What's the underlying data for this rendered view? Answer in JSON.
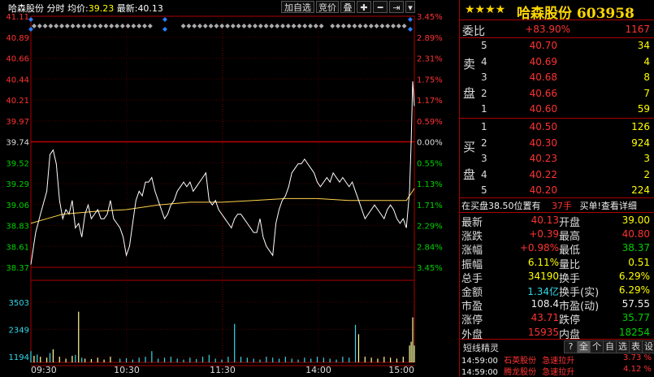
{
  "header": {
    "stock_name": "哈森股份",
    "mode": "分时",
    "avg_label": "均价:",
    "avg_value": "39.23",
    "last_label": "最新:",
    "last_value": "40.13",
    "buttons": [
      "加自选",
      "竞价",
      "叠"
    ],
    "icons": [
      "plus-icon",
      "minus-icon",
      "skip-end-icon",
      "chevron-down-icon"
    ]
  },
  "stock_header": {
    "stars": "★★★★",
    "title": "哈森股份 603958"
  },
  "weibi": {
    "label": "委比",
    "pct": "+83.90%",
    "value": "1167"
  },
  "sell_side_label": [
    "卖",
    "盘"
  ],
  "buy_side_label": [
    "买",
    "盘"
  ],
  "asks": [
    {
      "level": "5",
      "price": "40.70",
      "vol": "34"
    },
    {
      "level": "4",
      "price": "40.69",
      "vol": "4"
    },
    {
      "level": "3",
      "price": "40.68",
      "vol": "8"
    },
    {
      "level": "2",
      "price": "40.66",
      "vol": "7"
    },
    {
      "level": "1",
      "price": "40.60",
      "vol": "59"
    }
  ],
  "bids": [
    {
      "level": "1",
      "price": "40.50",
      "vol": "126"
    },
    {
      "level": "2",
      "price": "40.30",
      "vol": "924"
    },
    {
      "level": "3",
      "price": "40.23",
      "vol": "3"
    },
    {
      "level": "4",
      "price": "40.22",
      "vol": "2"
    },
    {
      "level": "5",
      "price": "40.20",
      "vol": "224"
    }
  ],
  "notice": {
    "text": "在买盘38.50位置有",
    "hands": "37手",
    "action": "买单!查看详细"
  },
  "quote": [
    {
      "l1": "最新",
      "v1": "40.13",
      "c1": "red",
      "l2": "开盘",
      "v2": "39.00",
      "c2": "yl"
    },
    {
      "l1": "涨跌",
      "v1": "+0.39",
      "c1": "red",
      "l2": "最高",
      "v2": "40.80",
      "c2": "red"
    },
    {
      "l1": "涨幅",
      "v1": "+0.98%",
      "c1": "red",
      "l2": "最低",
      "v2": "38.37",
      "c2": "grn"
    },
    {
      "l1": "振幅",
      "v1": "6.11%",
      "c1": "yl",
      "l2": "量比",
      "v2": "0.51",
      "c2": "yl"
    },
    {
      "l1": "总手",
      "v1": "34190",
      "c1": "yl",
      "l2": "换手",
      "v2": "6.29%",
      "c2": "yl"
    },
    {
      "l1": "金额",
      "v1": "1.34亿",
      "c1": "cy",
      "l2": "换手(实)",
      "v2": "6.29%",
      "c2": "yl"
    },
    {
      "l1": "市盈",
      "v1": "108.4",
      "c1": "wt",
      "l2": "市盈(动)",
      "v2": "57.55",
      "c2": "wt"
    },
    {
      "l1": "涨停",
      "v1": "43.71",
      "c1": "red",
      "l2": "跌停",
      "v2": "35.77",
      "c2": "grn"
    },
    {
      "l1": "外盘",
      "v1": "15935",
      "c1": "red",
      "l2": "内盘",
      "v2": "18254",
      "c2": "grn"
    }
  ],
  "sprite": {
    "title": "短线精灵",
    "tabs": [
      "?",
      "全",
      "个",
      "自",
      "选",
      "表",
      "设"
    ],
    "items": [
      {
        "time": "14:59:00",
        "name": "石英股份",
        "event": "急速拉升",
        "pct": "3.73 %"
      },
      {
        "time": "14:59:00",
        "name": "腾龙股份",
        "event": "急速拉升",
        "pct": "4.12 %"
      }
    ]
  },
  "chart_data": {
    "type": "line",
    "title": "",
    "prev_close": 39.74,
    "price_ticks": [
      "41.11",
      "40.89",
      "40.66",
      "40.44",
      "40.21",
      "39.97",
      "39.74",
      "39.52",
      "39.29",
      "39.06",
      "38.83",
      "38.61",
      "38.37"
    ],
    "pct_ticks": [
      "3.45%",
      "2.89%",
      "2.31%",
      "1.75%",
      "1.17%",
      "0.59%",
      "0.00%",
      "0.55%",
      "1.13%",
      "1.71%",
      "2.29%",
      "2.84%",
      "3.45%"
    ],
    "volume_ticks": [
      "3503",
      "2349",
      "1194"
    ],
    "time_ticks": [
      "09:30",
      "10:30",
      "11:30",
      "14:00",
      "15:00"
    ],
    "ylim": [
      38.37,
      41.11
    ],
    "volume_max": 4200,
    "price_series": {
      "name": "",
      "points": [
        [
          0,
          38.4
        ],
        [
          3,
          38.75
        ],
        [
          6,
          38.95
        ],
        [
          10,
          39.2
        ],
        [
          12,
          39.6
        ],
        [
          14,
          39.65
        ],
        [
          16,
          39.5
        ],
        [
          18,
          39.1
        ],
        [
          20,
          38.9
        ],
        [
          22,
          39.0
        ],
        [
          24,
          38.95
        ],
        [
          26,
          39.1
        ],
        [
          28,
          38.8
        ],
        [
          30,
          38.85
        ],
        [
          32,
          38.7
        ],
        [
          34,
          38.95
        ],
        [
          36,
          39.05
        ],
        [
          38,
          38.9
        ],
        [
          40,
          38.95
        ],
        [
          42,
          39.0
        ],
        [
          44,
          38.9
        ],
        [
          46,
          38.9
        ],
        [
          48,
          38.95
        ],
        [
          50,
          39.1
        ],
        [
          52,
          38.9
        ],
        [
          54,
          38.85
        ],
        [
          56,
          38.8
        ],
        [
          58,
          38.7
        ],
        [
          60,
          38.5
        ],
        [
          62,
          38.6
        ],
        [
          64,
          38.85
        ],
        [
          66,
          39.1
        ],
        [
          68,
          39.2
        ],
        [
          70,
          39.15
        ],
        [
          72,
          39.3
        ],
        [
          74,
          39.3
        ],
        [
          76,
          39.35
        ],
        [
          78,
          39.2
        ],
        [
          80,
          39.1
        ],
        [
          82,
          39.0
        ],
        [
          84,
          38.9
        ],
        [
          86,
          38.95
        ],
        [
          88,
          39.05
        ],
        [
          90,
          39.1
        ],
        [
          92,
          39.2
        ],
        [
          94,
          39.25
        ],
        [
          96,
          39.3
        ],
        [
          98,
          39.25
        ],
        [
          100,
          39.3
        ],
        [
          102,
          39.2
        ],
        [
          104,
          39.25
        ],
        [
          106,
          39.3
        ],
        [
          108,
          39.35
        ],
        [
          110,
          39.4
        ],
        [
          112,
          39.1
        ],
        [
          114,
          39.05
        ],
        [
          116,
          39.1
        ],
        [
          118,
          39.0
        ],
        [
          120,
          38.95
        ],
        [
          122,
          38.9
        ],
        [
          124,
          38.85
        ],
        [
          126,
          38.8
        ],
        [
          128,
          38.9
        ],
        [
          130,
          38.95
        ],
        [
          132,
          38.95
        ],
        [
          134,
          38.9
        ],
        [
          136,
          38.85
        ],
        [
          138,
          38.8
        ],
        [
          140,
          38.75
        ],
        [
          142,
          38.75
        ],
        [
          144,
          38.9
        ],
        [
          146,
          38.7
        ],
        [
          148,
          38.6
        ],
        [
          150,
          38.55
        ],
        [
          152,
          38.5
        ],
        [
          154,
          38.85
        ],
        [
          156,
          39.0
        ],
        [
          158,
          39.1
        ],
        [
          160,
          39.15
        ],
        [
          162,
          39.25
        ],
        [
          164,
          39.4
        ],
        [
          166,
          39.45
        ],
        [
          168,
          39.5
        ],
        [
          170,
          39.5
        ],
        [
          172,
          39.55
        ],
        [
          174,
          39.5
        ],
        [
          176,
          39.45
        ],
        [
          178,
          39.4
        ],
        [
          180,
          39.3
        ],
        [
          182,
          39.25
        ],
        [
          184,
          39.3
        ],
        [
          186,
          39.35
        ],
        [
          188,
          39.3
        ],
        [
          190,
          39.4
        ],
        [
          192,
          39.35
        ],
        [
          194,
          39.3
        ],
        [
          196,
          39.35
        ],
        [
          198,
          39.3
        ],
        [
          200,
          39.25
        ],
        [
          202,
          39.3
        ],
        [
          204,
          39.2
        ],
        [
          206,
          39.1
        ],
        [
          208,
          39.0
        ],
        [
          210,
          38.9
        ],
        [
          212,
          38.95
        ],
        [
          214,
          39.0
        ],
        [
          216,
          39.05
        ],
        [
          218,
          39.0
        ],
        [
          220,
          38.95
        ],
        [
          222,
          38.9
        ],
        [
          224,
          39.0
        ],
        [
          226,
          39.05
        ],
        [
          228,
          39.0
        ],
        [
          230,
          38.9
        ],
        [
          232,
          38.85
        ],
        [
          234,
          38.9
        ],
        [
          236,
          38.8
        ],
        [
          238,
          39.2
        ],
        [
          239,
          39.74
        ],
        [
          240,
          40.4
        ],
        [
          241,
          40.13
        ]
      ]
    },
    "avg_series": {
      "name": "",
      "points": [
        [
          0,
          38.85
        ],
        [
          10,
          38.9
        ],
        [
          20,
          38.95
        ],
        [
          40,
          38.98
        ],
        [
          60,
          39.0
        ],
        [
          80,
          39.05
        ],
        [
          100,
          39.08
        ],
        [
          120,
          39.08
        ],
        [
          140,
          39.1
        ],
        [
          160,
          39.12
        ],
        [
          180,
          39.12
        ],
        [
          200,
          39.1
        ],
        [
          220,
          39.1
        ],
        [
          236,
          39.1
        ],
        [
          241,
          39.23
        ]
      ]
    },
    "volume_bars": [
      [
        0,
        600
      ],
      [
        2,
        350
      ],
      [
        4,
        420
      ],
      [
        6,
        300
      ],
      [
        10,
        250
      ],
      [
        12,
        500
      ],
      [
        14,
        700
      ],
      [
        18,
        300
      ],
      [
        22,
        200
      ],
      [
        26,
        350
      ],
      [
        28,
        400
      ],
      [
        30,
        2700
      ],
      [
        32,
        250
      ],
      [
        34,
        200
      ],
      [
        38,
        180
      ],
      [
        42,
        250
      ],
      [
        46,
        150
      ],
      [
        50,
        300
      ],
      [
        56,
        200
      ],
      [
        60,
        220
      ],
      [
        64,
        150
      ],
      [
        68,
        250
      ],
      [
        72,
        300
      ],
      [
        76,
        600
      ],
      [
        80,
        200
      ],
      [
        84,
        250
      ],
      [
        88,
        300
      ],
      [
        92,
        200
      ],
      [
        96,
        150
      ],
      [
        100,
        250
      ],
      [
        104,
        180
      ],
      [
        108,
        300
      ],
      [
        112,
        400
      ],
      [
        116,
        200
      ],
      [
        120,
        150
      ],
      [
        124,
        300
      ],
      [
        128,
        2050
      ],
      [
        132,
        300
      ],
      [
        136,
        250
      ],
      [
        140,
        200
      ],
      [
        144,
        150
      ],
      [
        148,
        300
      ],
      [
        152,
        250
      ],
      [
        156,
        200
      ],
      [
        160,
        300
      ],
      [
        164,
        200
      ],
      [
        168,
        150
      ],
      [
        172,
        250
      ],
      [
        176,
        200
      ],
      [
        180,
        300
      ],
      [
        184,
        250
      ],
      [
        188,
        200
      ],
      [
        192,
        150
      ],
      [
        196,
        300
      ],
      [
        200,
        250
      ],
      [
        204,
        2000
      ],
      [
        206,
        1500
      ],
      [
        210,
        300
      ],
      [
        214,
        250
      ],
      [
        218,
        200
      ],
      [
        222,
        300
      ],
      [
        226,
        250
      ],
      [
        230,
        200
      ],
      [
        234,
        300
      ],
      [
        238,
        900
      ],
      [
        239,
        1100
      ],
      [
        240,
        2400
      ],
      [
        241,
        900
      ]
    ]
  }
}
